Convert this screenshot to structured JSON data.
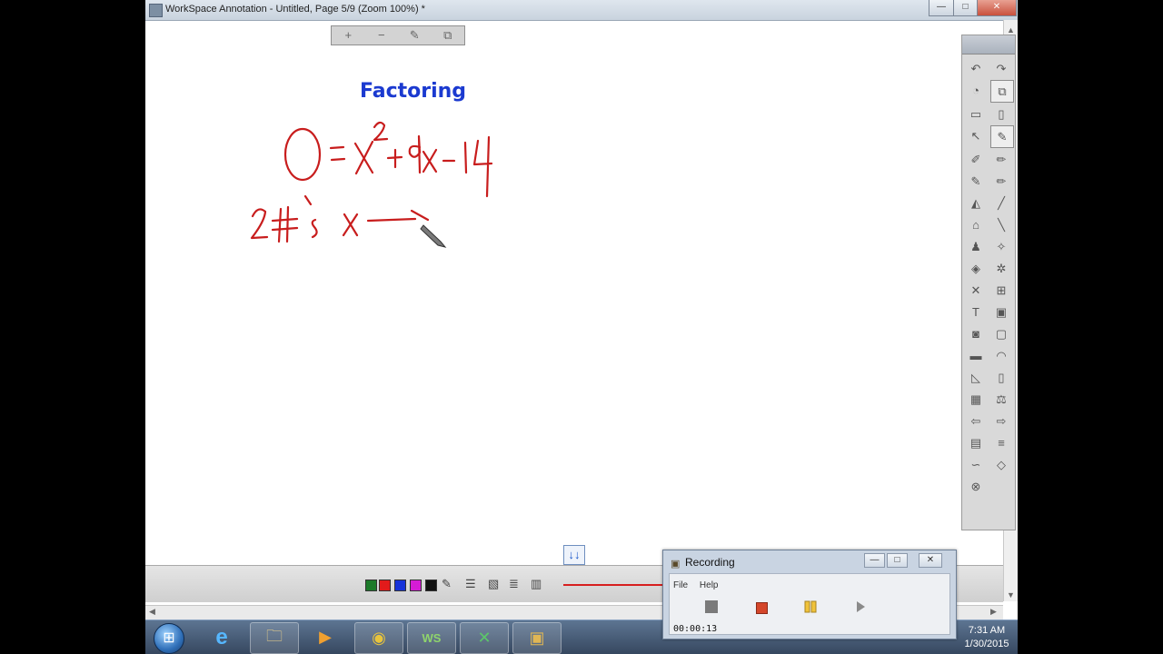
{
  "window": {
    "title": "WorkSpace Annotation - Untitled, Page 5/9  (Zoom 100%) *",
    "minimize_label": "—",
    "maximize_label": "□",
    "close_label": "✕"
  },
  "canvas_toolbar": {
    "add_page_label": "+",
    "remove_page_label": "−",
    "edit_label": "✎",
    "copy_label": "⧉"
  },
  "page": {
    "heading": "Factoring"
  },
  "bottom_toolbar": {
    "page_down_label": "↓↓",
    "colors": [
      "#1c7a2a",
      "#e21b1b",
      "#1533d9",
      "#d51cd5",
      "#111111"
    ]
  },
  "recording_window": {
    "title": "Recording",
    "menu": [
      "File",
      "Help"
    ],
    "elapsed_time": "00:00:13",
    "colors": {
      "stop": "#7a7a7a",
      "record": "#d4462a",
      "pause": "#f0c33a",
      "play": "#8a8a8a"
    }
  },
  "taskbar": {
    "start_label": "⊞",
    "apps": [
      {
        "name": "internet-explorer",
        "glyph": "e"
      },
      {
        "name": "file-explorer",
        "glyph": "🗀"
      },
      {
        "name": "media-player",
        "glyph": "▶"
      },
      {
        "name": "chrome",
        "glyph": "◉"
      },
      {
        "name": "workspace",
        "glyph": "WS"
      },
      {
        "name": "excel",
        "glyph": "✕"
      },
      {
        "name": "recorder",
        "glyph": "▣"
      }
    ],
    "clock_time": "7:31 AM",
    "clock_date": "1/30/2015"
  }
}
